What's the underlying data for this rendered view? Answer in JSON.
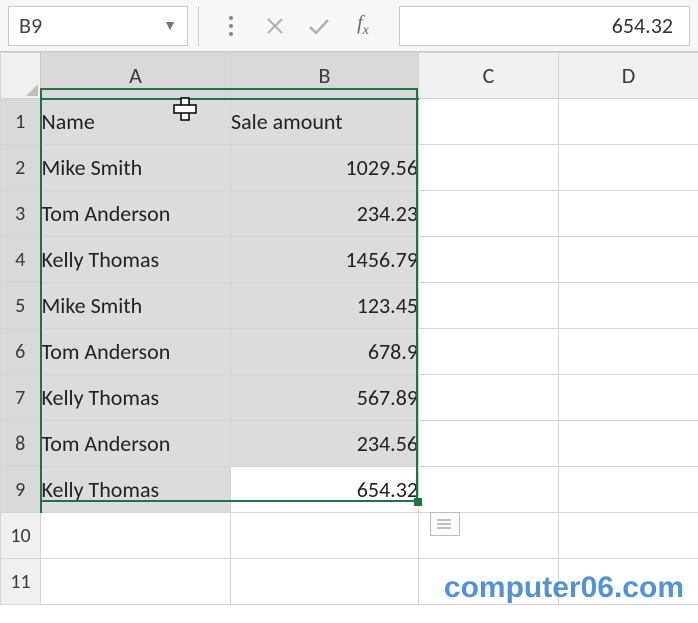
{
  "formulaBar": {
    "nameBox": "B9",
    "formulaValue": "654.32"
  },
  "columns": [
    "A",
    "B",
    "C",
    "D"
  ],
  "rows": [
    "1",
    "2",
    "3",
    "4",
    "5",
    "6",
    "7",
    "8",
    "9",
    "10",
    "11"
  ],
  "headers": {
    "colA": "Name",
    "colB": "Sale amount"
  },
  "data": [
    {
      "name": "Mike Smith",
      "amount": "1029.56"
    },
    {
      "name": "Tom Anderson",
      "amount": "234.23"
    },
    {
      "name": "Kelly Thomas",
      "amount": "1456.79"
    },
    {
      "name": "Mike Smith",
      "amount": "123.45"
    },
    {
      "name": "Tom Anderson",
      "amount": "678.9"
    },
    {
      "name": "Kelly Thomas",
      "amount": "567.89"
    },
    {
      "name": "Tom Anderson",
      "amount": "234.56"
    },
    {
      "name": "Kelly Thomas",
      "amount": "654.32"
    }
  ],
  "selection": {
    "range": "A1:B9",
    "activeCell": "B9"
  },
  "watermark": "computer06.com",
  "colors": {
    "selectionBorder": "#217346",
    "headerBg": "#f0f0f0"
  }
}
